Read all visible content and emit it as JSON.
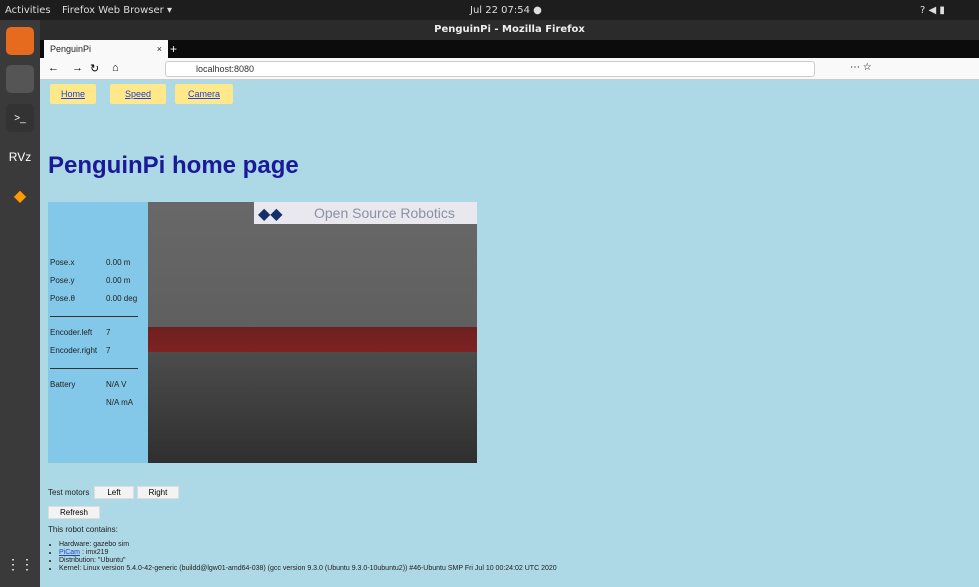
{
  "system": {
    "activities": "Activities",
    "app_menu": "Firefox Web Browser ▾",
    "clock": "Jul 22  07:54  ●"
  },
  "window": {
    "title": "PenguinPi - Mozilla Firefox",
    "tab_title": "PenguinPi",
    "url": "localhost:8080"
  },
  "nav": {
    "home": "Home",
    "speed": "Speed",
    "camera": "Camera"
  },
  "page": {
    "title": "PenguinPi home page"
  },
  "pose": {
    "x_label": "Pose.x",
    "x_value": "0.00 m",
    "y_label": "Pose.y",
    "y_value": "0.00 m",
    "theta_label": "Pose.θ",
    "theta_value": "0.00 deg"
  },
  "encoders": {
    "left_label": "Encoder.left",
    "left_value": "7",
    "right_label": "Encoder.right",
    "right_value": "7"
  },
  "battery": {
    "label": "Battery",
    "voltage": "N/A V",
    "current": "N/A mA"
  },
  "camera_banner_text": "Open Source Robotics",
  "controls": {
    "test_motors_label": "Test motors",
    "left_button": "Left",
    "right_button": "Right",
    "refresh_button": "Refresh"
  },
  "robot_info": {
    "heading": "This robot contains:",
    "hardware": "Hardware: gazebo sim",
    "picam_link": "PiCam",
    "picam_rest": ": imx219",
    "distribution": "Distribution: \"Ubuntu\"",
    "kernel": "Kernel: Linux version 5.4.0-42-generic (buildd@lgw01-amd64-038) (gcc version 9.3.0 (Ubuntu 9.3.0-10ubuntu2)) #46-Ubuntu SMP Fri Jul 10 00:24:02 UTC 2020"
  }
}
